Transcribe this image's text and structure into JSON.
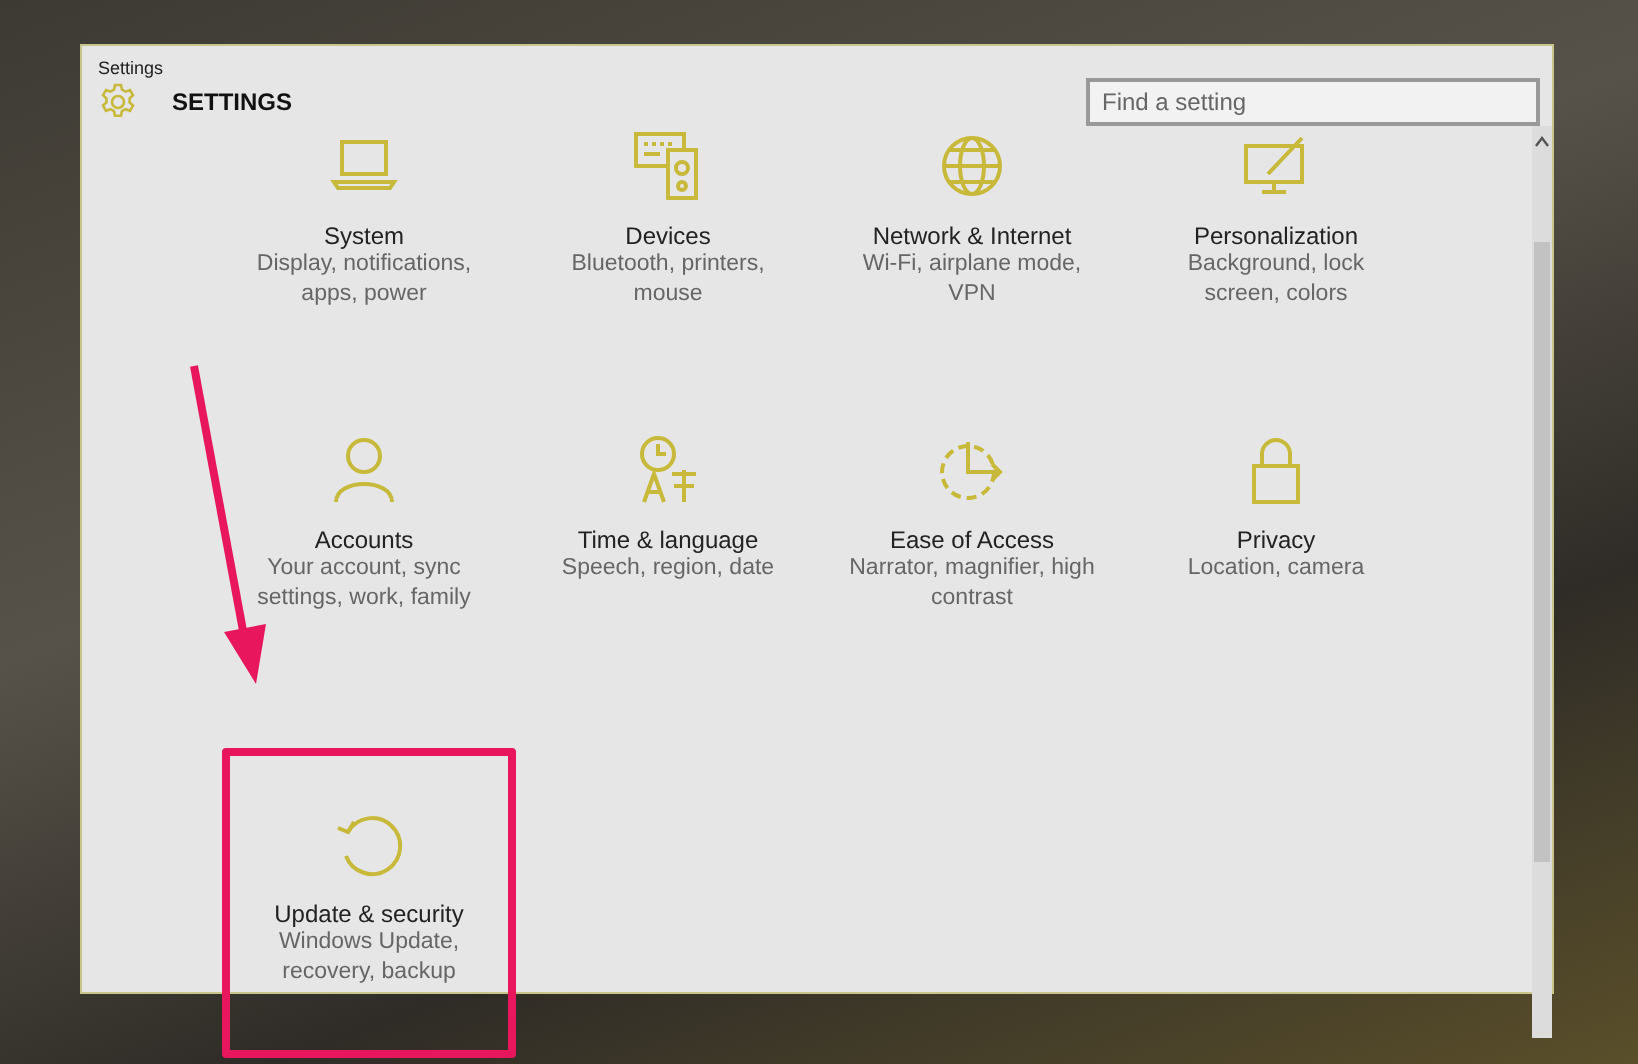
{
  "window": {
    "title": "Settings"
  },
  "header": {
    "title": "SETTINGS"
  },
  "search": {
    "placeholder": "Find a setting"
  },
  "categories": [
    {
      "label": "System",
      "description": "Display, notifications, apps, power",
      "highlighted": false
    },
    {
      "label": "Devices",
      "description": "Bluetooth, printers, mouse",
      "highlighted": false
    },
    {
      "label": "Network & Internet",
      "description": "Wi-Fi, airplane mode, VPN",
      "highlighted": false
    },
    {
      "label": "Personalization",
      "description": "Background, lock screen, colors",
      "highlighted": false
    },
    {
      "label": "Accounts",
      "description": "Your account, sync settings, work, family",
      "highlighted": false
    },
    {
      "label": "Time & language",
      "description": "Speech, region, date",
      "highlighted": false
    },
    {
      "label": "Ease of Access",
      "description": "Narrator, magnifier, high contrast",
      "highlighted": false
    },
    {
      "label": "Privacy",
      "description": "Location, camera",
      "highlighted": false
    },
    {
      "label": "Update & security",
      "description": "Windows Update, recovery, backup",
      "highlighted": true
    }
  ]
}
